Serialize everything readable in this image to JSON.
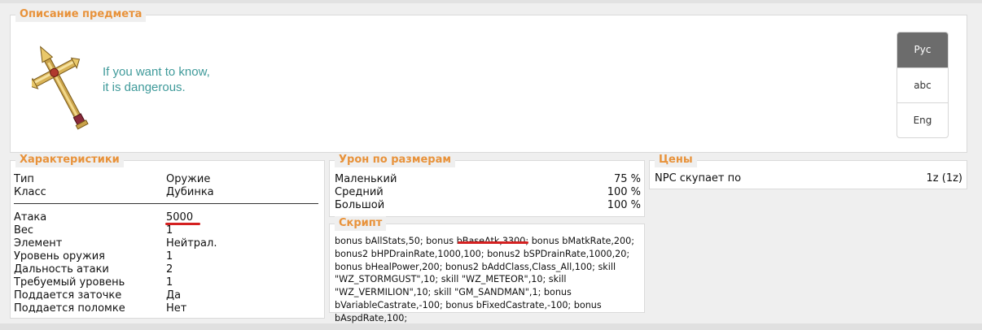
{
  "description": {
    "legend": "Описание предмета",
    "item_icon": "holy-cross-mace-icon",
    "text_line1": "If you want to know,",
    "text_line2": "it is dangerous.",
    "languages": [
      "Рус",
      "abc",
      "Eng"
    ],
    "active_language": "Рус"
  },
  "stats": {
    "legend": "Характеристики",
    "top_rows": [
      {
        "key": "Тип",
        "value": "Оружие"
      },
      {
        "key": "Класс",
        "value": "Дубинка"
      }
    ],
    "rows": [
      {
        "key": "Атака",
        "value": "5000"
      },
      {
        "key": "Вес",
        "value": "1"
      },
      {
        "key": "Элемент",
        "value": "Нейтрал."
      },
      {
        "key": "Уровень оружия",
        "value": "1"
      },
      {
        "key": "Дальность атаки",
        "value": "2"
      },
      {
        "key": "Требуемый уровень",
        "value": "1"
      },
      {
        "key": "Поддается заточке",
        "value": "Да"
      },
      {
        "key": "Поддается поломке",
        "value": "Нет"
      }
    ]
  },
  "sizes": {
    "legend": "Урон по размерам",
    "rows": [
      {
        "key": "Маленький",
        "value": "75 %"
      },
      {
        "key": "Средний",
        "value": "100 %"
      },
      {
        "key": "Большой",
        "value": "100 %"
      }
    ]
  },
  "script": {
    "legend": "Скрипт",
    "before": "bonus bAllStats,50; bonus ",
    "highlight": "bBaseAtk,3300",
    "after": "; bonus bMatkRate,200; bonus2 bHPDrainRate,1000,100; bonus2 bSPDrainRate,1000,20; bonus bHealPower,200; bonus2 bAddClass,Class_All,100; skill \"WZ_STORMGUST\",10; skill \"WZ_METEOR\",10; skill \"WZ_VERMILION\",10; skill \"GM_SANDMAN\",1; bonus bVariableCastrate,-100; bonus bFixedCastrate,-100; bonus bAspdRate,100;"
  },
  "prices": {
    "legend": "Цены",
    "rows": [
      {
        "key": "NPC скупает по",
        "value": "1z (1z)"
      }
    ]
  },
  "colors": {
    "legend_orange": "#e8923a",
    "description_teal": "#3f9a9a",
    "active_tab": "#6c6c6c",
    "highlight_red": "#d42020"
  }
}
